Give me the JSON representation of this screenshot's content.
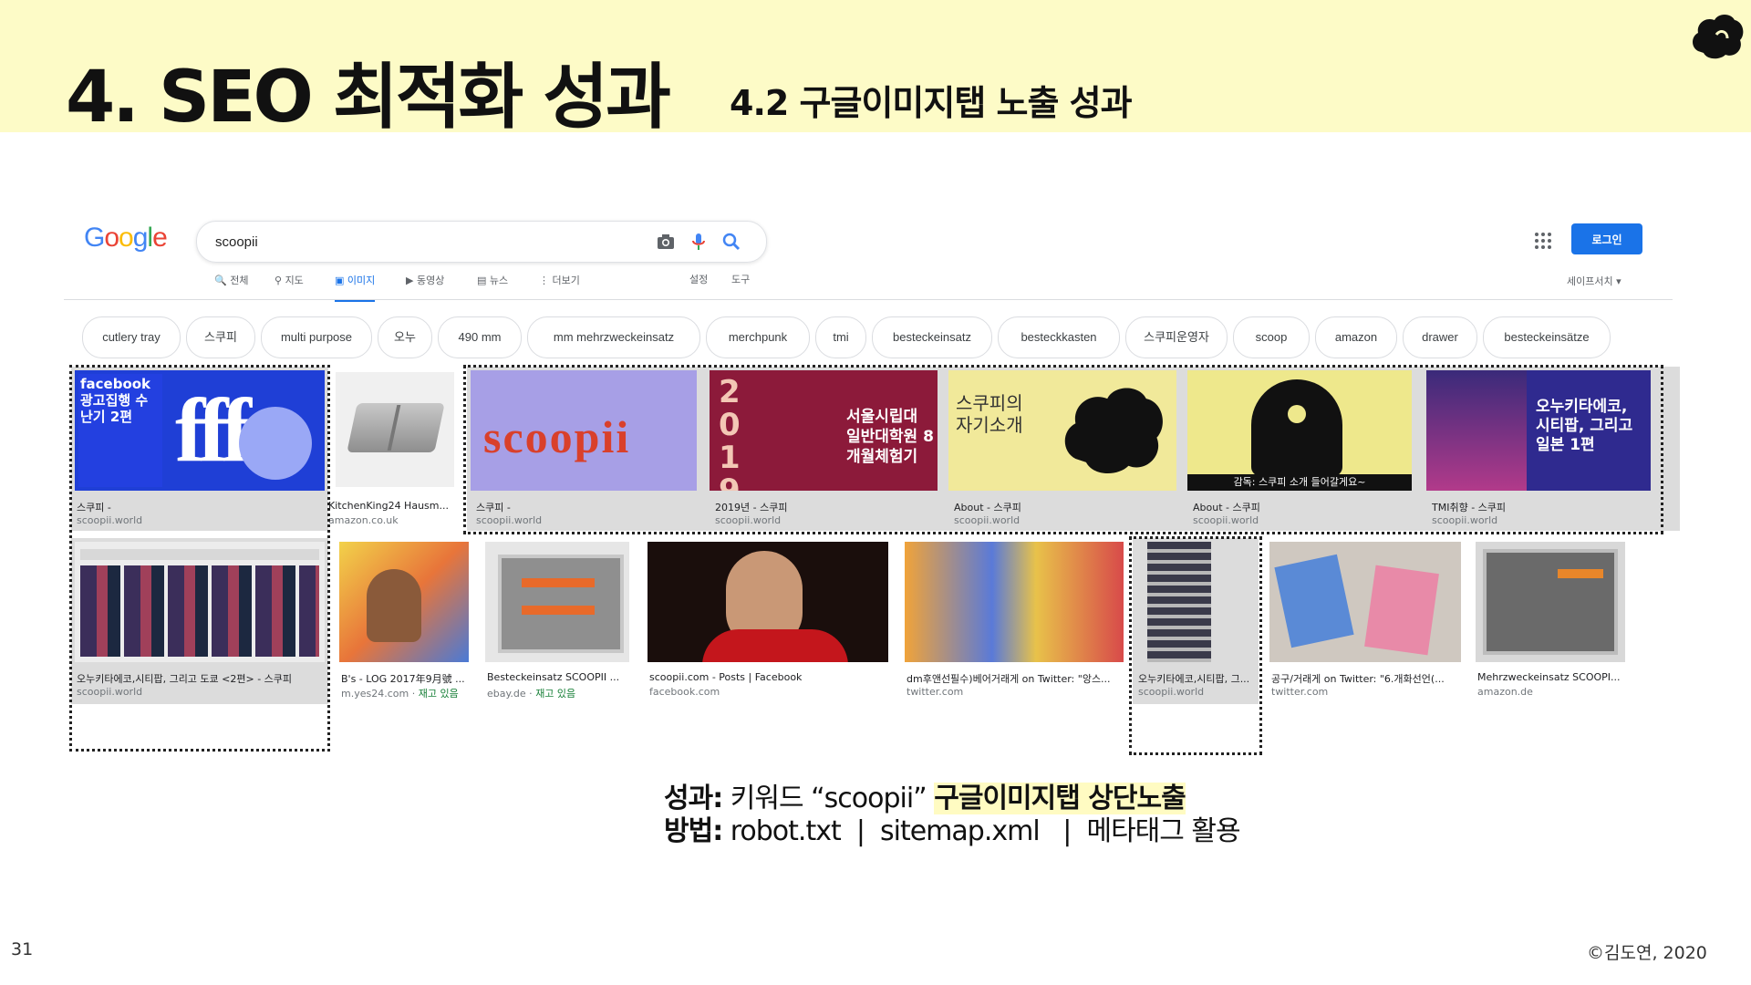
{
  "slide": {
    "title": "4. SEO 최적화 성과",
    "subtitle": "4.2 구글이미지탭 노출 성과",
    "logo_icon": "brand-logo-icon",
    "page_number": "31",
    "copyright": "©김도연, 2020"
  },
  "google": {
    "logo_letters": [
      "G",
      "o",
      "o",
      "g",
      "l",
      "e"
    ],
    "search_value": "scoopii",
    "search_icons": [
      "camera-icon",
      "microphone-icon",
      "search-icon"
    ],
    "tabs": [
      {
        "icon": "🔍",
        "label": "전체"
      },
      {
        "icon": "⚲",
        "label": "지도"
      },
      {
        "icon": "▣",
        "label": "이미지",
        "active": true
      },
      {
        "icon": "▶",
        "label": "동영상"
      },
      {
        "icon": "▤",
        "label": "뉴스"
      },
      {
        "icon": "⋮",
        "label": "더보기"
      }
    ],
    "settings": "설정",
    "tools": "도구",
    "login": "로그인",
    "safesearch": "세이프서치 ▾",
    "chips": [
      "cutlery tray",
      "스쿠피",
      "multi purpose",
      "오누",
      "490 mm",
      "mm mehrzweckeinsatz",
      "merchpunk",
      "tmi",
      "besteckeinsatz",
      "besteckkasten",
      "스쿠피운영자",
      "scoop",
      "amazon",
      "drawer",
      "besteckeinsätze"
    ],
    "results_row1": [
      {
        "title": "스쿠피 -",
        "source": "scoopii.world",
        "img_text": "facebook 광고집행 수난기 2편",
        "highlight": true
      },
      {
        "title": "KitchenKing24 Hausm...",
        "source": "amazon.co.uk",
        "img_text": "",
        "highlight": false
      },
      {
        "title": "스쿠피 -",
        "source": "scoopii.world",
        "img_text": "scoopii",
        "highlight": true
      },
      {
        "title": "2019년 - 스쿠피",
        "source": "scoopii.world",
        "img_text": "서울시립대 일반대학원 8개월체험기",
        "highlight": true
      },
      {
        "title": "About - 스쿠피",
        "source": "scoopii.world",
        "img_text": "스쿠피의 자기소개",
        "highlight": true
      },
      {
        "title": "About - 스쿠피",
        "source": "scoopii.world",
        "img_text": "감독: 스쿠피 소개 들어갈게요~",
        "highlight": true
      },
      {
        "title": "TMI취향 - 스쿠피",
        "source": "scoopii.world",
        "img_text": "오누키타에코, 시티팝, 그리고 일본 1편",
        "highlight": true
      }
    ],
    "results_row2": [
      {
        "title": "오누키타에코,시티팝, 그리고 도쿄 <2편> - 스쿠피",
        "source": "scoopii.world",
        "stock": "",
        "highlight": true
      },
      {
        "title": "B's - LOG 2017年9月號 ...",
        "source": "m.yes24.com",
        "stock": "재고 있음",
        "highlight": false
      },
      {
        "title": "Besteckeinsatz SCOOPII ...",
        "source": "ebay.de",
        "stock": "재고 있음",
        "highlight": false
      },
      {
        "title": "scoopii.com - Posts | Facebook",
        "source": "facebook.com",
        "stock": "",
        "highlight": false
      },
      {
        "title": "dm후앤선필수)베어거래게 on Twitter: \"앙스...",
        "source": "twitter.com",
        "stock": "",
        "highlight": false
      },
      {
        "title": "오누키타에코,시티팝, 그...",
        "source": "scoopii.world",
        "stock": "",
        "highlight": true
      },
      {
        "title": "공구/거래게 on Twitter: \"6.개화선언(...",
        "source": "twitter.com",
        "stock": "",
        "highlight": false
      },
      {
        "title": "Mehrzweckeinsatz SCOOPI...",
        "source": "amazon.de",
        "stock": "",
        "highlight": false
      }
    ]
  },
  "summary": {
    "line1_label": "성과:",
    "line1_text": " 키워드 “scoopii” ",
    "line1_mark": "구글이미지탭 상단노출",
    "line2_label": "방법:",
    "line2_text": " robot.txt  |  sitemap.xml   |  메타태그 활용"
  },
  "colors": {
    "header_bg": "#fdfbc7",
    "accent_blue": "#1a73e8"
  }
}
